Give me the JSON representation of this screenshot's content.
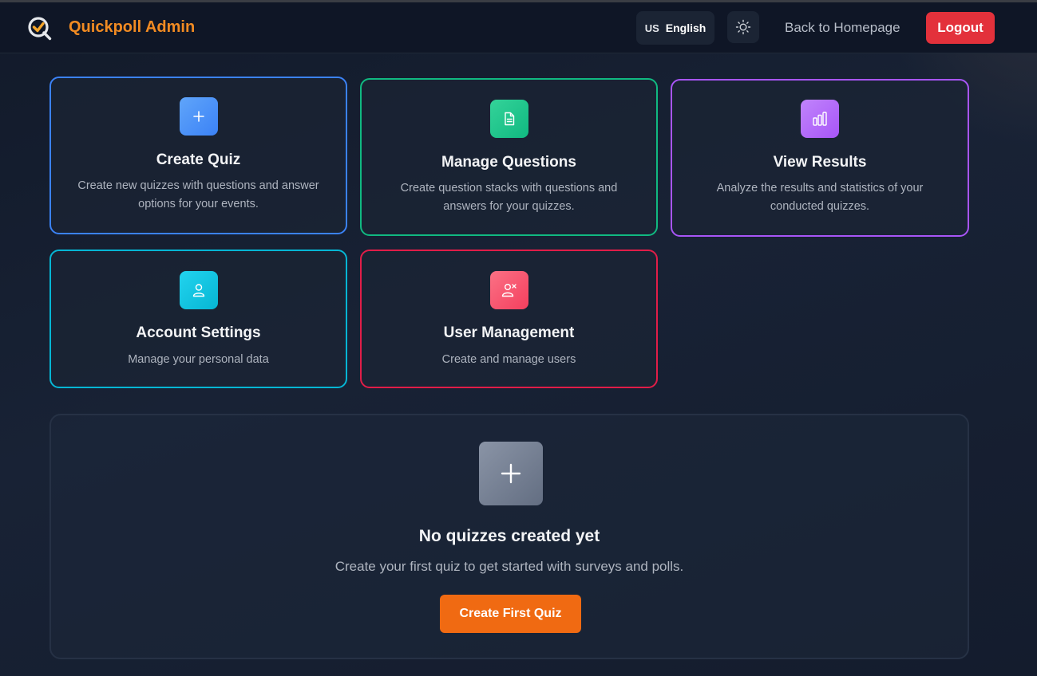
{
  "navbar": {
    "brand": "Quickpoll Admin",
    "language_flag": "US",
    "language_label": "English",
    "back_link": "Back to Homepage",
    "logout_label": "Logout"
  },
  "cards": [
    {
      "title": "Create Quiz",
      "description": "Create new quizzes with questions and answer options for your events.",
      "icon": "plus-icon",
      "border_color": "#3b82f6"
    },
    {
      "title": "Manage Questions",
      "description": "Create question stacks with questions and answers for your quizzes.",
      "icon": "document-icon",
      "border_color": "#10b981"
    },
    {
      "title": "View Results",
      "description": "Analyze the results and statistics of your conducted quizzes.",
      "icon": "bar-chart-icon",
      "border_color": "#a855f7"
    },
    {
      "title": "Account Settings",
      "description": "Manage your personal data",
      "icon": "user-icon",
      "border_color": "#06b6d4"
    },
    {
      "title": "User Management",
      "description": "Create and manage users",
      "icon": "users-manage-icon",
      "border_color": "#e11d48"
    }
  ],
  "empty_state": {
    "title": "No quizzes created yet",
    "description": "Create your first quiz to get started with surveys and polls.",
    "button_label": "Create First Quiz"
  },
  "colors": {
    "brand": "#f28b22",
    "logout": "#e3313b",
    "primary_action": "#f06a12"
  }
}
